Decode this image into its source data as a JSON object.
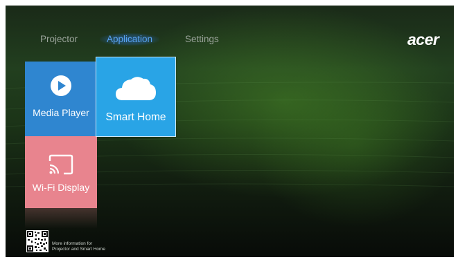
{
  "nav": {
    "tabs": [
      {
        "label": "Projector",
        "active": false
      },
      {
        "label": "Application",
        "active": true
      },
      {
        "label": "Settings",
        "active": false
      }
    ]
  },
  "brand": {
    "logo_text": "acer"
  },
  "tiles": [
    {
      "label": "Media Player",
      "icon": "play-icon",
      "color": "#2f86d0"
    },
    {
      "label": "Smart Home",
      "icon": "cloud-icon",
      "color": "#29a4e6",
      "focused": true
    },
    {
      "label": "Wi-Fi Display",
      "icon": "cast-icon",
      "color": "#e8848e"
    }
  ],
  "footer": {
    "info_line1": "More information for",
    "info_line2": "Projector and Smart Home"
  },
  "colors": {
    "active_tab": "#5aa3f0",
    "inactive_tab": "#9aa39a"
  }
}
